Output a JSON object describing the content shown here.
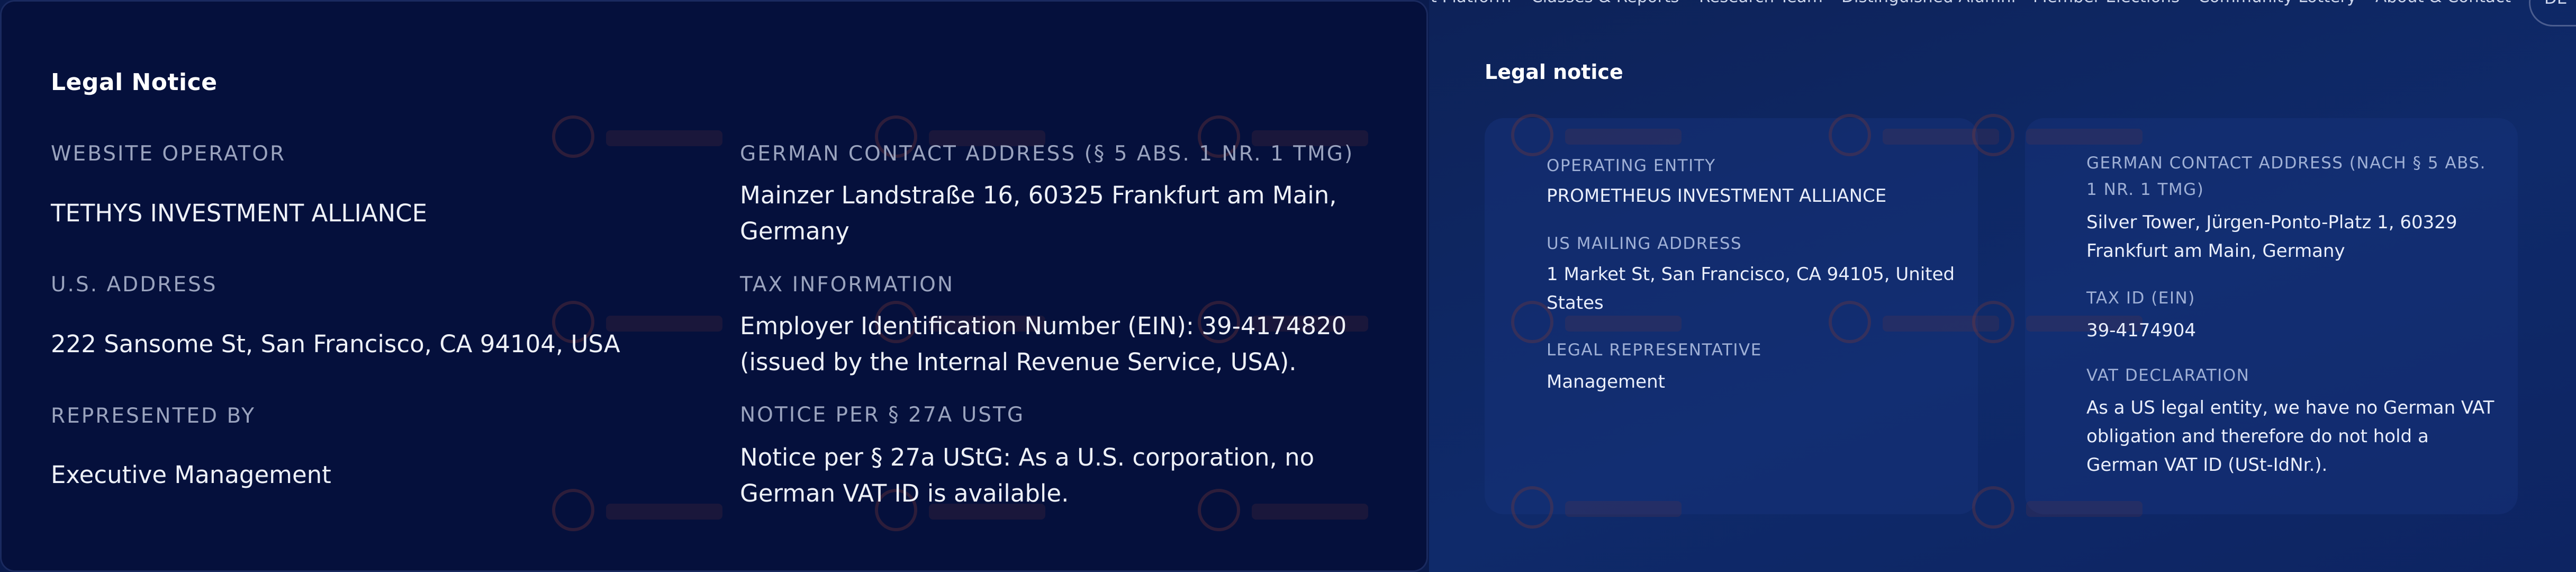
{
  "left": {
    "title": "Legal Notice",
    "operator_label": "WEBSITE OPERATOR",
    "operator_value": "TETHYS INVESTMENT ALLIANCE",
    "us_address_label": "U.S. ADDRESS",
    "us_address_value": "222 Sansome St, San Francisco, CA 94104, USA",
    "represented_label": "REPRESENTED BY",
    "represented_value": "Executive Management",
    "german_label": "GERMAN CONTACT ADDRESS (§ 5 ABS. 1 NR. 1 TMG)",
    "german_value": "Mainzer Landstraße 16, 60325 Frankfurt am Main, Germany",
    "tax_label": "TAX INFORMATION",
    "tax_value": "Employer Identification Number (EIN): 39-4174820 (issued by the Internal Revenue Service, USA).",
    "ustg_label": "NOTICE PER § 27A USTG",
    "ustg_value": "Notice per § 27a UStG: As a U.S. corporation, no German VAT ID is available."
  },
  "nav": {
    "items": [
      "it Platform",
      "Classes & Reports",
      "Research Team",
      "Distinguished Alumni",
      "Member Elections",
      "Community Lottery",
      "About & Contact"
    ],
    "pill": "DE"
  },
  "right": {
    "title": "Legal notice",
    "operating_label": "OPERATING ENTITY",
    "operating_value": "PROMETHEUS INVESTMENT ALLIANCE",
    "mailing_label": "US MAILING ADDRESS",
    "mailing_value": "1 Market St, San Francisco, CA 94105, United States",
    "rep_label": "LEGAL REPRESENTATIVE",
    "rep_value": "Management",
    "german_label": "GERMAN CONTACT ADDRESS (NACH § 5 ABS. 1 NR. 1 TMG)",
    "german_value": "Silver Tower, Jürgen-Ponto-Platz 1, 60329 Frankfurt am Main, Germany",
    "taxid_label": "TAX ID (EIN)",
    "taxid_value": "39-4174904",
    "vat_label": "VAT DECLARATION",
    "vat_value": "As a US legal entity, we have no German VAT obligation and therefore do not hold a German VAT ID (USt-IdNr.)."
  },
  "colors": {
    "left_bg": "#05103c",
    "right_bg": "#0f2a6a",
    "label": "#9aa3be",
    "text": "#eef1f8"
  }
}
